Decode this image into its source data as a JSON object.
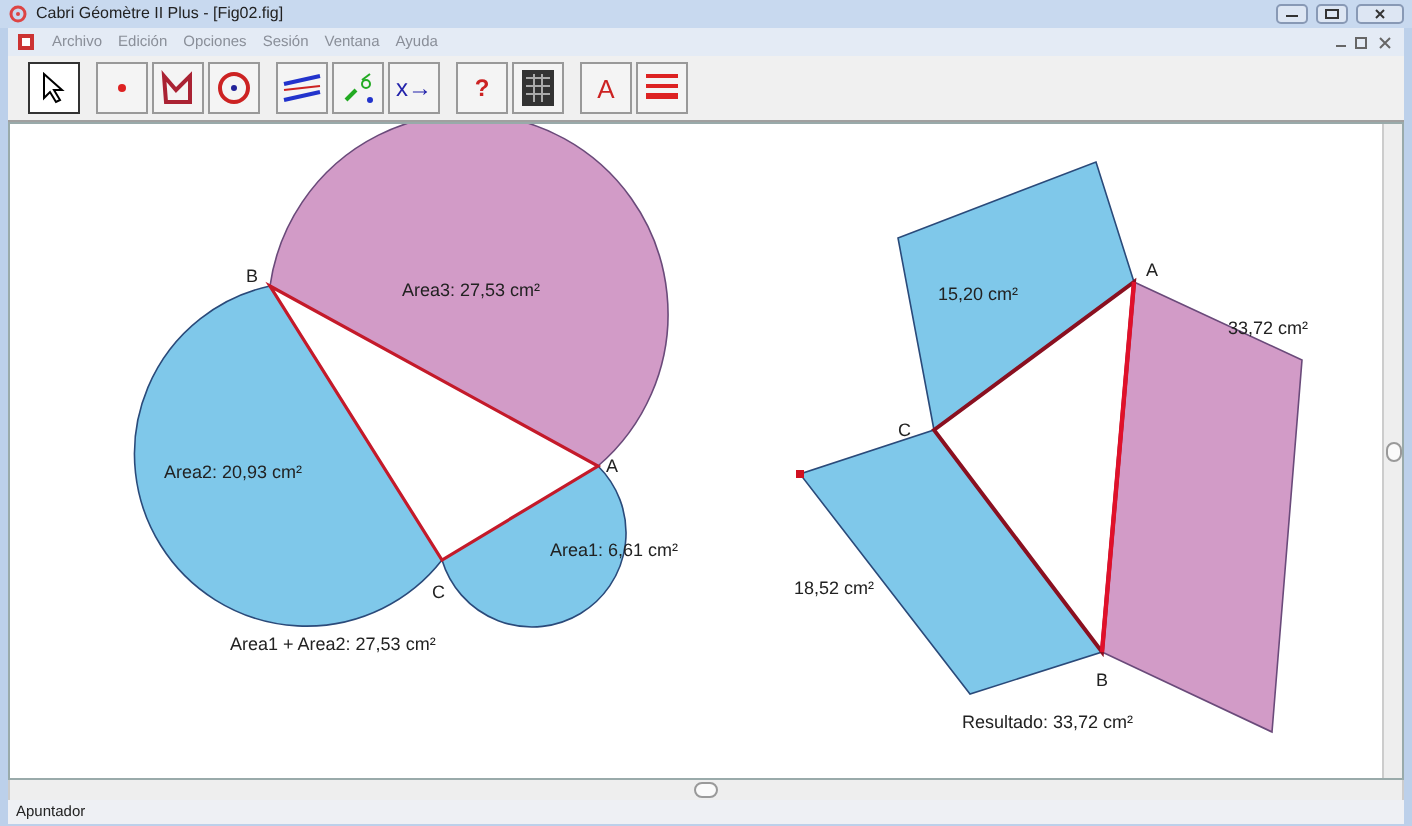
{
  "window": {
    "title": "Cabri Géomètre II Plus - [Fig02.fig]"
  },
  "menu": [
    "Archivo",
    "Edición",
    "Opciones",
    "Sesión",
    "Ventana",
    "Ayuda"
  ],
  "tools": [
    {
      "kind": "pointer",
      "selected": true
    },
    {
      "kind": "point",
      "selected": false
    },
    {
      "kind": "polygon",
      "selected": false
    },
    {
      "kind": "circle",
      "selected": false
    },
    {
      "kind": "lines",
      "selected": false
    },
    {
      "kind": "transform",
      "selected": false
    },
    {
      "kind": "calc",
      "glyph": "x→",
      "selected": false
    },
    {
      "kind": "macro",
      "glyph": "?",
      "selected": false
    },
    {
      "kind": "table",
      "selected": false
    },
    {
      "kind": "text",
      "glyph": "A",
      "selected": false
    },
    {
      "kind": "style",
      "selected": false
    }
  ],
  "left_figure": {
    "vertices": [
      "A",
      "B",
      "C"
    ],
    "areas": [
      "Area1: 6,61 cm²",
      "Area2: 20,93 cm²",
      "Area3: 27,53 cm²"
    ],
    "sum": "Area1 + Area2: 27,53 cm²"
  },
  "right_figure": {
    "vertices": [
      "A",
      "B",
      "C"
    ],
    "areas": [
      "15,20 cm²",
      "18,52 cm²",
      "33,72 cm²"
    ],
    "result": "Resultado: 33,72 cm²"
  },
  "status_bar": "Apuntador"
}
